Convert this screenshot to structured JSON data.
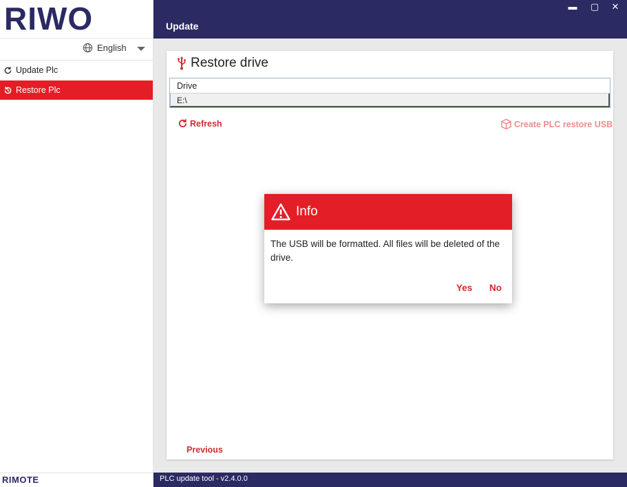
{
  "app": {
    "logo": "RIWO",
    "brand_footer": "RIMOTE",
    "page_title": "Update",
    "version": "PLC update tool - v2.4.0.0"
  },
  "window_controls": {
    "minimize": "▬",
    "maximize": "▢",
    "close": "✕"
  },
  "language": {
    "selected": "English"
  },
  "sidebar": {
    "items": [
      {
        "label": "Update Plc",
        "active": false
      },
      {
        "label": "Restore Plc",
        "active": true
      }
    ]
  },
  "content": {
    "title": "Restore drive",
    "table": {
      "header": "Drive",
      "rows": [
        "E:\\"
      ]
    },
    "refresh_label": "Refresh",
    "create_usb_label": "Create PLC restore USB",
    "previous_label": "Previous"
  },
  "dialog": {
    "title": "Info",
    "message": "The USB will be formatted. All files will be deleted of the drive.",
    "yes_label": "Yes",
    "no_label": "No"
  },
  "colors": {
    "primary": "#2b2a63",
    "accent": "#e31e26",
    "accent_text": "#d42a30"
  }
}
